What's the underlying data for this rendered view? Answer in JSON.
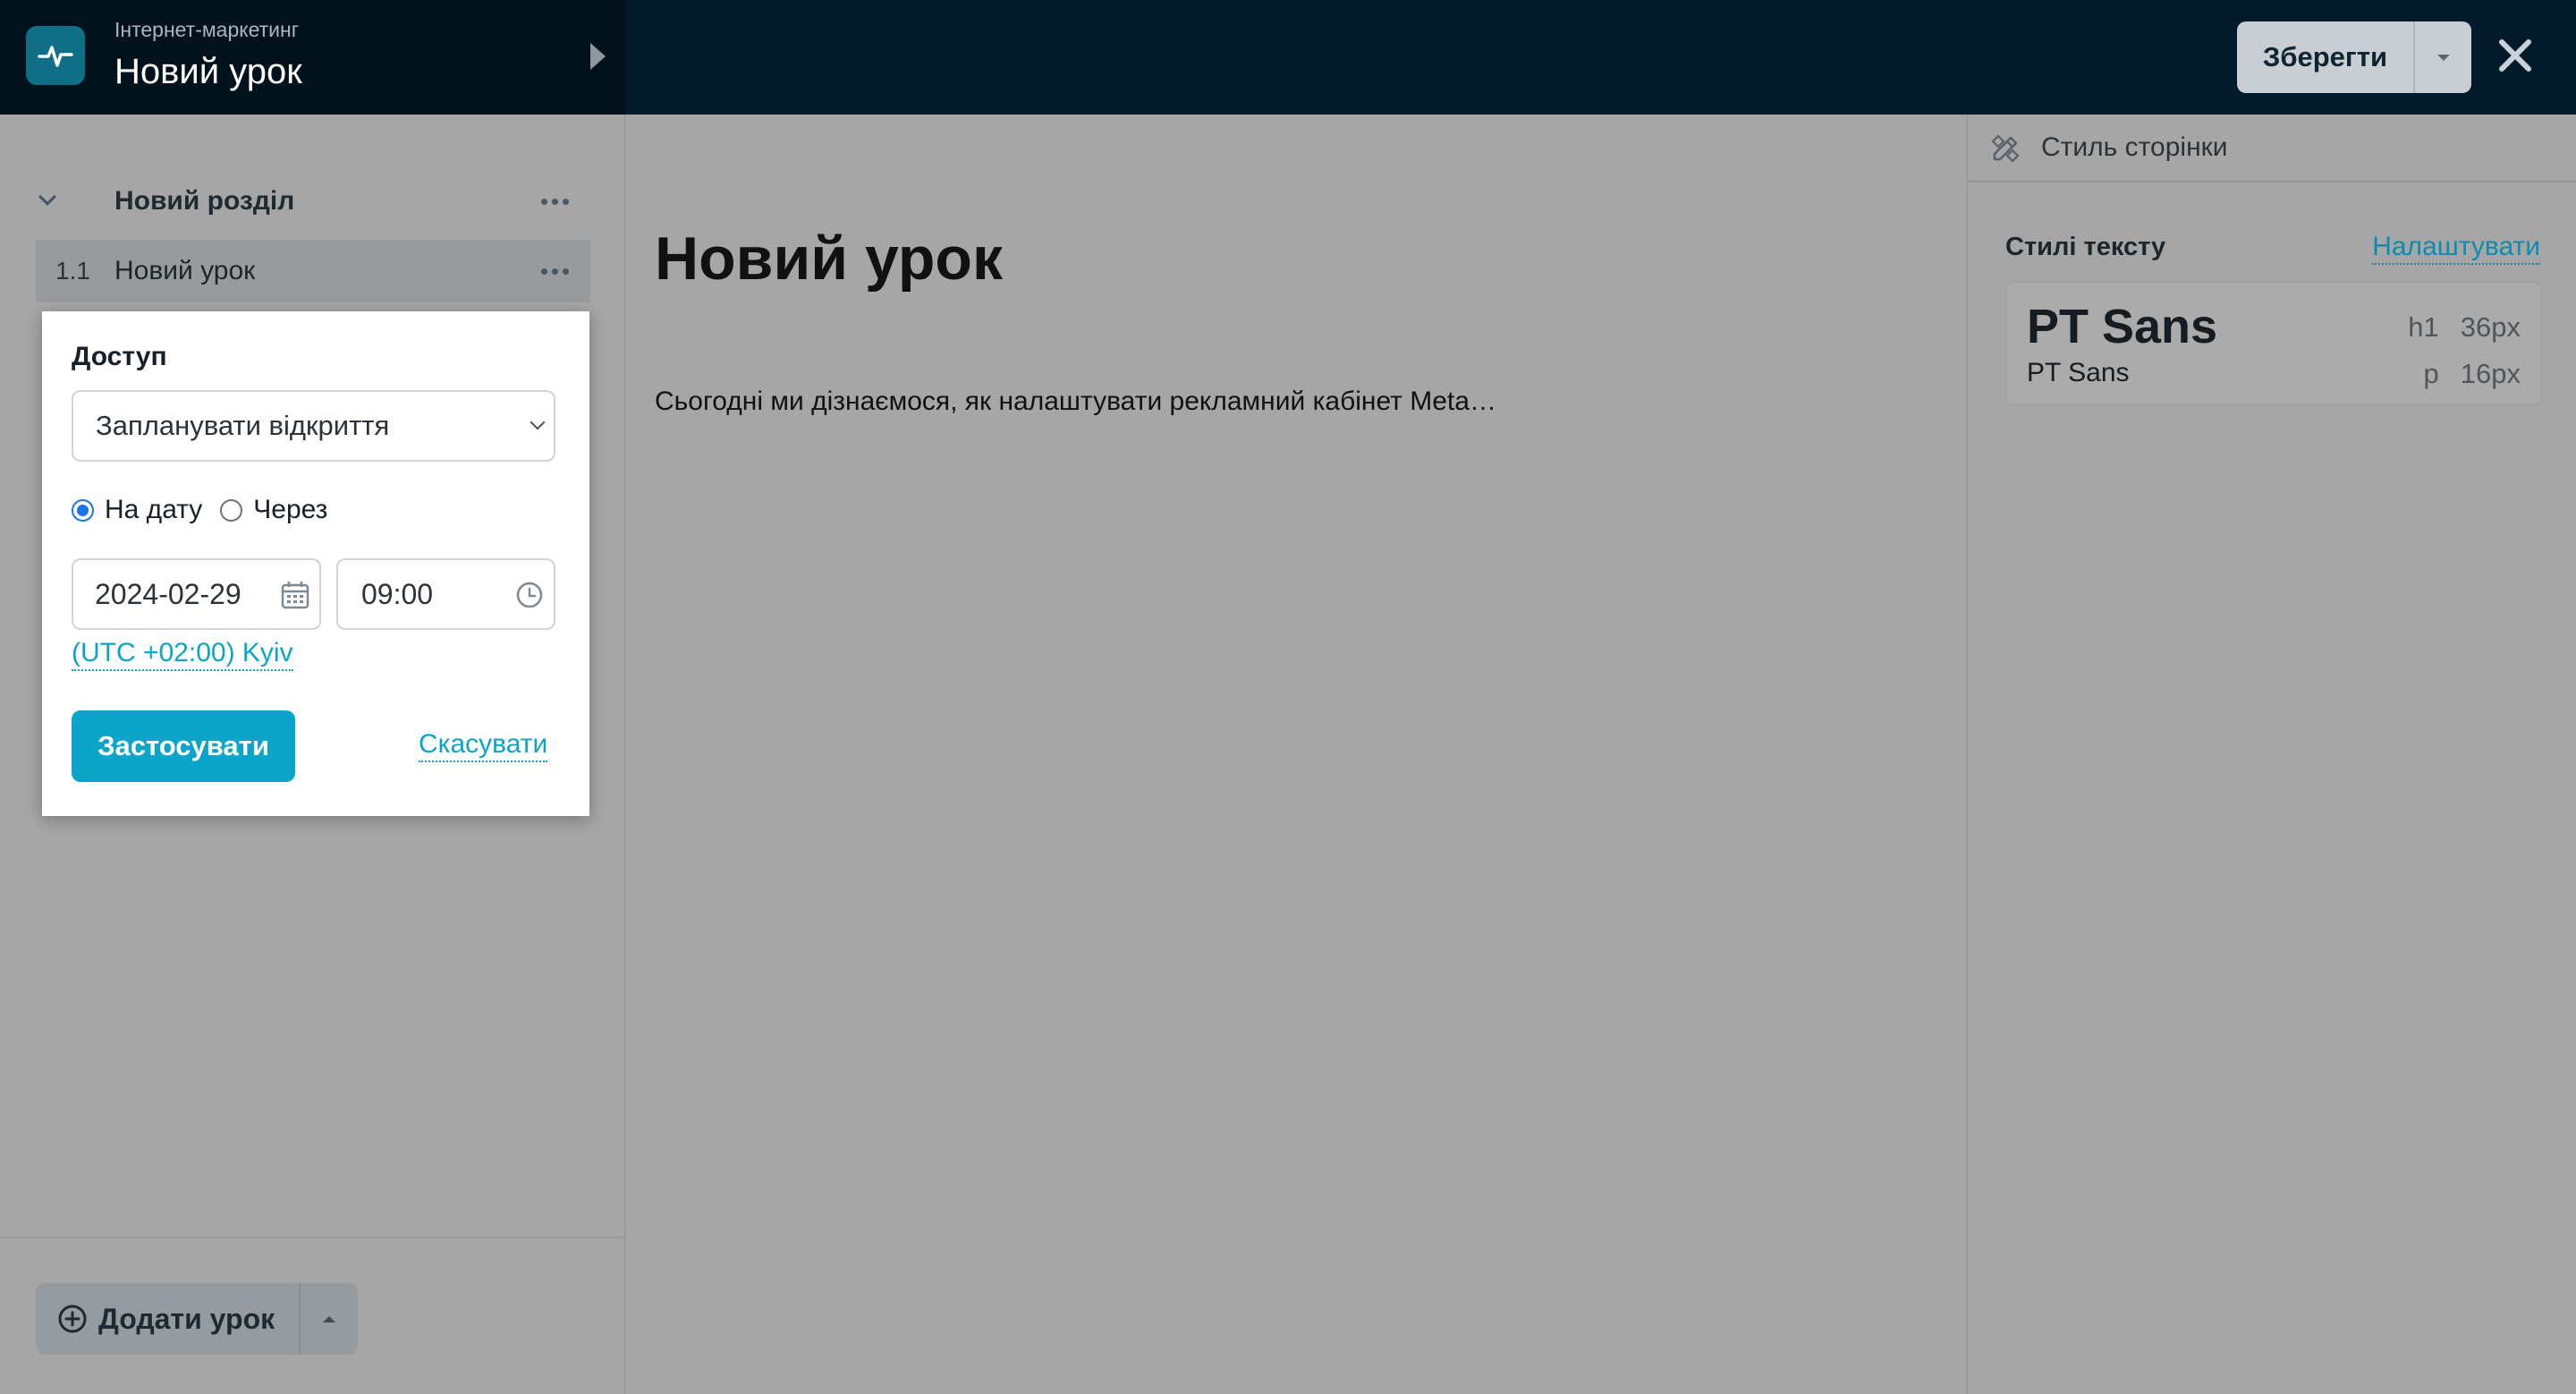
{
  "header": {
    "course_name": "Інтернет-маркетинг",
    "lesson_title": "Новий урок",
    "save_label": "Зберегти",
    "logo_icon": "pulse-icon",
    "close_icon": "close-icon"
  },
  "sidebar": {
    "section": {
      "title": "Новий розділ"
    },
    "lessons": [
      {
        "number": "1.1",
        "title": "Новий урок"
      }
    ],
    "add_lesson_label": "Додати урок"
  },
  "access_popover": {
    "title": "Доступ",
    "select_value": "Запланувати відкриття",
    "radio_options": [
      {
        "label": "На дату",
        "checked": true
      },
      {
        "label": "Через",
        "checked": false
      }
    ],
    "date_value": "2024-02-29",
    "time_value": "09:00",
    "timezone": "(UTC +02:00) Kyiv",
    "apply_label": "Застосувати",
    "cancel_label": "Скасувати"
  },
  "content": {
    "heading": "Новий урок",
    "paragraph": "Сьогодні ми дізнаємося, як налаштувати рекламний кабінет Meta…"
  },
  "right_panel": {
    "header_title": "Стиль сторінки",
    "text_styles_label": "Стилі тексту",
    "configure_label": "Налаштувати",
    "font_card": {
      "h1_font": "PT Sans",
      "p_font": "PT Sans",
      "h1_tag": "h1",
      "h1_size": "36px",
      "p_tag": "p",
      "p_size": "16px"
    }
  },
  "colors": {
    "accent": "#0aa5c9",
    "topbar": "#021b2b",
    "overlay_gray": "#a6a6a6"
  }
}
